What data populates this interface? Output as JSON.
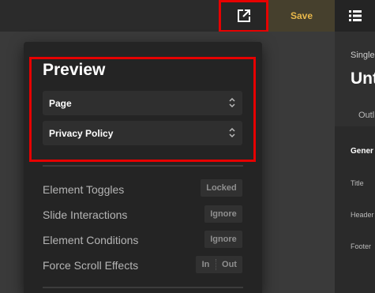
{
  "toolbar": {
    "external_link_icon": "external-link-icon",
    "save_label": "Save",
    "menu_icon": "list-menu-icon",
    "save_color": "#e9b84b"
  },
  "right_panel": {
    "subtitle": "Single",
    "title": "Unt",
    "tab": "Outl",
    "section": "Gener",
    "fields": [
      "Title",
      "Header",
      "Footer"
    ]
  },
  "preview": {
    "title": "Preview",
    "selects": [
      {
        "value": "Page"
      },
      {
        "value": "Privacy Policy"
      }
    ],
    "options": [
      {
        "label": "Element Toggles",
        "state": "Locked"
      },
      {
        "label": "Slide Interactions",
        "state": "Ignore"
      },
      {
        "label": "Element Conditions",
        "state": "Ignore"
      },
      {
        "label": "Force Scroll Effects",
        "segments": [
          "In",
          "Out"
        ]
      }
    ]
  },
  "highlight_color": "#e60000"
}
